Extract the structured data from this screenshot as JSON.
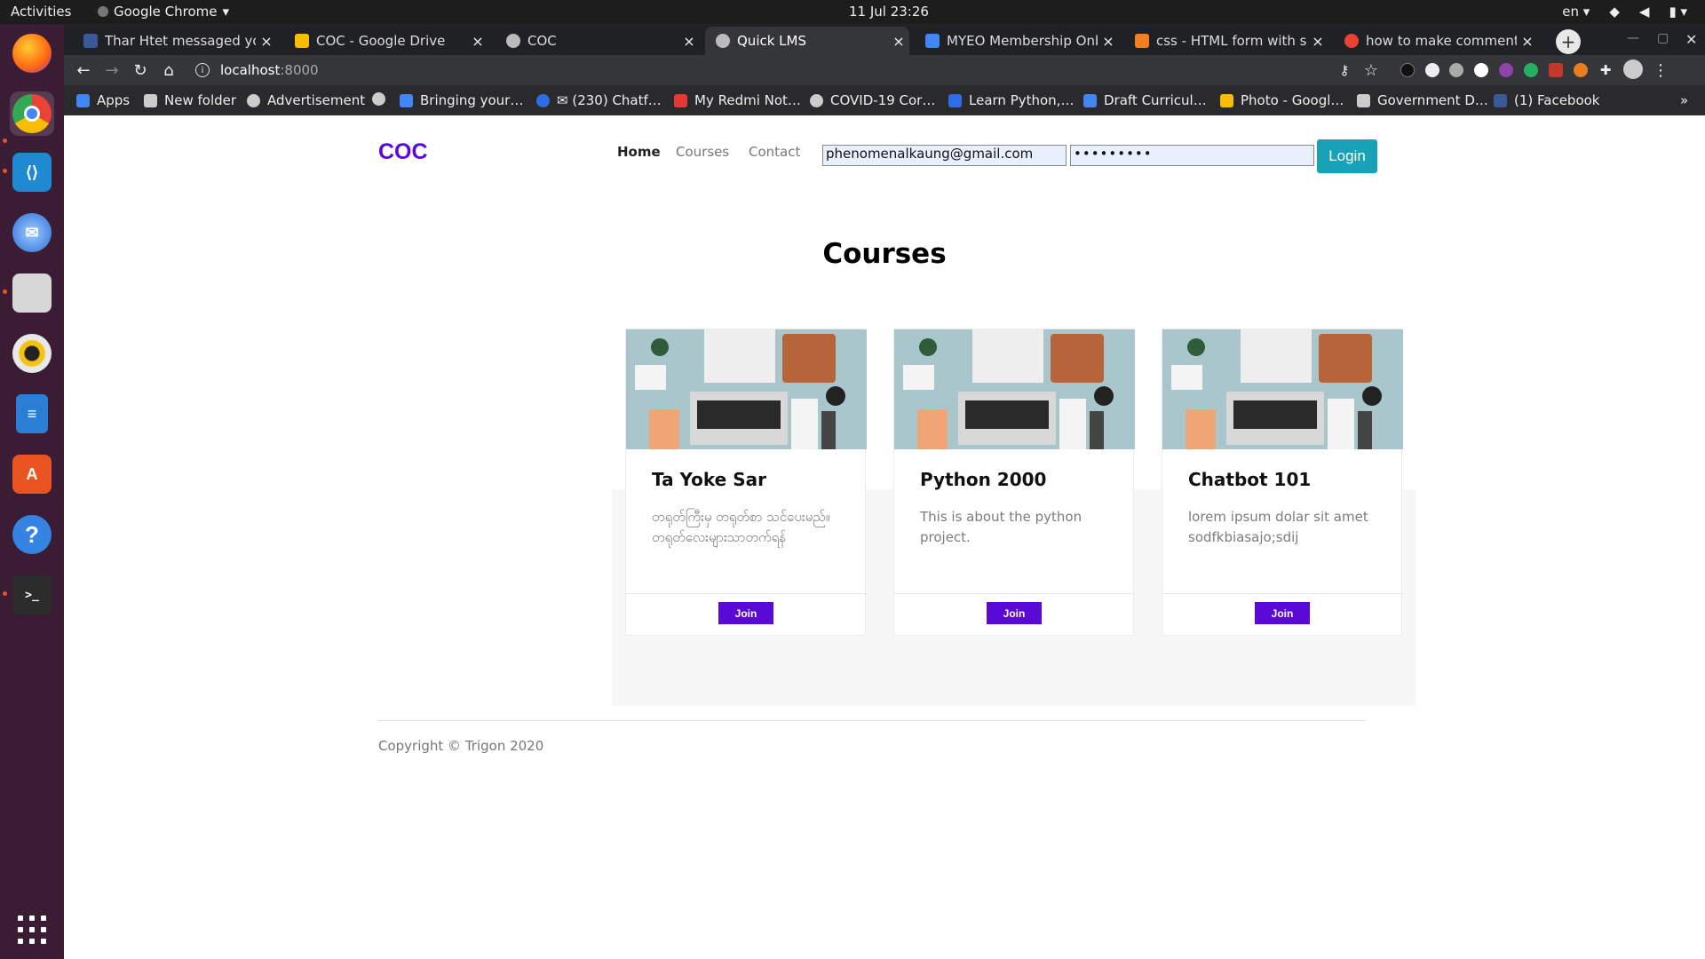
{
  "system_bar": {
    "activities": "Activities",
    "app_name": "Google Chrome",
    "clock": "11 Jul  23:26",
    "language": "en"
  },
  "tabs": [
    {
      "title": "Thar Htet messaged you",
      "favicon_color": "#3b5998"
    },
    {
      "title": "COC - Google Drive",
      "favicon_color": "#fbbc04"
    },
    {
      "title": "COC",
      "favicon_color": "#bbbbbb"
    },
    {
      "title": "Quick LMS",
      "favicon_color": "#bbbbbb"
    },
    {
      "title": "MYEO Membership Onbo",
      "favicon_color": "#4285f4"
    },
    {
      "title": "css - HTML form with side",
      "favicon_color": "#f48024"
    },
    {
      "title": "how to make comments i",
      "favicon_color": "#ea4335"
    }
  ],
  "address_bar": {
    "host": "localhost",
    "port": ":8000"
  },
  "bookmarks": [
    {
      "label": "Apps",
      "color": "#4285f4"
    },
    {
      "label": "New folder",
      "color": "#cccccc"
    },
    {
      "label": "Advertisement",
      "color": "#cccccc"
    },
    {
      "label": "",
      "color": "#cccccc"
    },
    {
      "label": "Bringing your…",
      "color": "#4285f4"
    },
    {
      "label": "✉ (230) Chatf…",
      "color": "#2d6de8"
    },
    {
      "label": "My Redmi Not…",
      "color": "#e53935"
    },
    {
      "label": "COVID-19 Cor…",
      "color": "#cccccc"
    },
    {
      "label": "Learn Python,…",
      "color": "#2d6de8"
    },
    {
      "label": "Draft Curricul…",
      "color": "#4285f4"
    },
    {
      "label": "Photo - Googl…",
      "color": "#fbbc04"
    },
    {
      "label": "Government D…",
      "color": "#cccccc"
    },
    {
      "label": "(1) Facebook",
      "color": "#3b5998"
    }
  ],
  "site": {
    "brand": "COC",
    "nav": [
      "Home",
      "Courses",
      "Contact"
    ],
    "email_value": "phenomenalkaung@gmail.com",
    "password_value": "•••••••••",
    "login_label": "Login",
    "section_title": "Courses",
    "courses": [
      {
        "title": "Ta Yoke Sar",
        "description": "တရုတ်ကြီးမှ တရုတ်စာ သင်ပေးမည်။ တရုတ်လေးများသာတက်ရန်",
        "join_label": "Join"
      },
      {
        "title": "Python 2000",
        "description": "This is about the python project.",
        "join_label": "Join"
      },
      {
        "title": "Chatbot 101",
        "description": "lorem ipsum dolar sit amet sodfkbiasajo;sdij",
        "join_label": "Join"
      }
    ],
    "copyright": "Copyright © Trigon 2020"
  },
  "colors": {
    "brand": "#5b09d6",
    "login_button": "#17a2b8",
    "dock": "#3a1d35"
  }
}
